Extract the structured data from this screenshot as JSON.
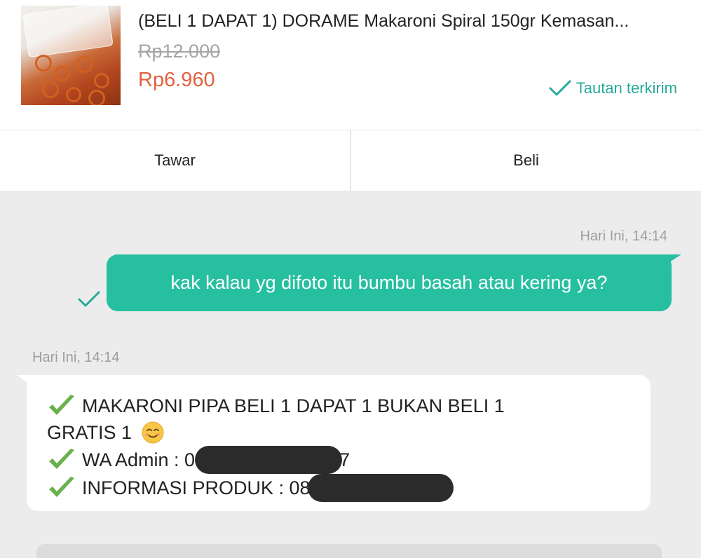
{
  "product": {
    "title": "(BELI 1 DAPAT 1) DORAME Makaroni Spiral 150gr Kemasan...",
    "price_original": "Rp12.000",
    "price_current": "Rp6.960",
    "link_status": "Tautan terkirim",
    "image_icon": "product-thumbnail"
  },
  "actions": {
    "offer_label": "Tawar",
    "buy_label": "Beli"
  },
  "chat": {
    "outgoing": {
      "timestamp": "Hari Ini, 14:14",
      "text": "kak kalau yg difoto itu bumbu basah atau kering ya?",
      "status_icon": "checkmark-sent-icon"
    },
    "incoming": {
      "timestamp": "Hari Ini, 14:14",
      "line1": "MAKARONI PIPA BELI 1 DAPAT 1 BUKAN BELI 1",
      "line2": "GRATIS 1",
      "line3_prefix": "WA Admin : 0",
      "line3_suffix": "7",
      "line4_prefix": "INFORMASI PRODUK : 08",
      "emoji": "smiling-face"
    }
  },
  "colors": {
    "accent": "#26bfa0",
    "price": "#e1613f",
    "link_status": "#26aa99",
    "background": "#ececec"
  }
}
